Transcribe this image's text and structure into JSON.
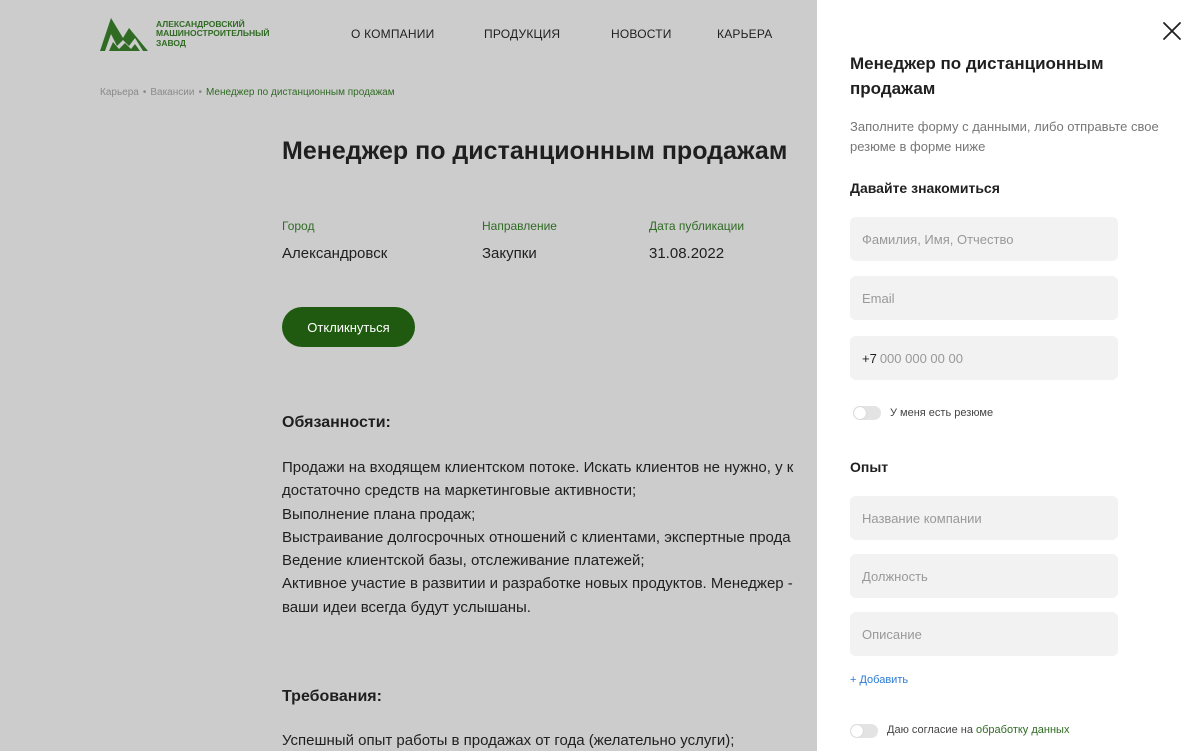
{
  "header": {
    "logo_lines": [
      "АЛЕКСАНДРОВСКИЙ",
      "МАШИНОСТРОИТЕЛЬНЫЙ",
      "ЗАВОД"
    ],
    "nav": [
      "О КОМПАНИИ",
      "ПРОДУКЦИЯ",
      "НОВОСТИ",
      "КАРЬЕРА"
    ]
  },
  "breadcrumb": {
    "items": [
      "Карьера",
      "Вакансии"
    ],
    "separator": "•",
    "current": "Менеджер по дистанционным продажам"
  },
  "vacancy": {
    "title": "Менеджер по дистанционным продажам",
    "meta": [
      {
        "label": "Город",
        "value": "Александровск"
      },
      {
        "label": "Направление",
        "value": "Закупки"
      },
      {
        "label": "Дата публикации",
        "value": "31.08.2022"
      }
    ],
    "respond_label": "Откликнуться",
    "duties_heading": "Обязанности:",
    "duties_lines": [
      "Продажи на входящем клиентском потоке. Искать клиентов не нужно, у к",
      "достаточно средств на маркетинговые активности;",
      "Выполнение плана продаж;",
      "Выстраивание долгосрочных отношений с клиентами, экспертные прода",
      "Ведение клиентской базы, отслеживание платежей;",
      "Активное участие в развитии и разработке новых продуктов. Менеджер -",
      "ваши идеи всегда будут услышаны."
    ],
    "requirements_heading": "Требования:",
    "requirements_first_line": "Успешный опыт работы в продажах от года (желательно услуги);"
  },
  "panel": {
    "title": "Менеджер по дистанционным продажам",
    "subtitle": "Заполните форму с данными, либо отправьте свое резюме в форме ниже",
    "intro_heading": "Давайте знакомиться",
    "fullname_placeholder": "Фамилия, Имя, Отчество",
    "email_placeholder": "Email",
    "phone_prefix": "+7",
    "phone_placeholder": "000 000 00 00",
    "resume_toggle_label": "У меня есть резюме",
    "experience_heading": "Опыт",
    "company_placeholder": "Название компании",
    "position_placeholder": "Должность",
    "description_placeholder": "Описание",
    "add_label": "+ Добавить",
    "consent_text": "Даю согласие на",
    "consent_link": "обработку данных"
  },
  "colors": {
    "brand_green": "#2f6b23",
    "button_green": "#1f5a10",
    "overlay_gray": "#cccccc",
    "link_blue": "#2b7bd6"
  },
  "icons": {
    "logo": "mountain-logo-icon",
    "close": "close-icon"
  }
}
